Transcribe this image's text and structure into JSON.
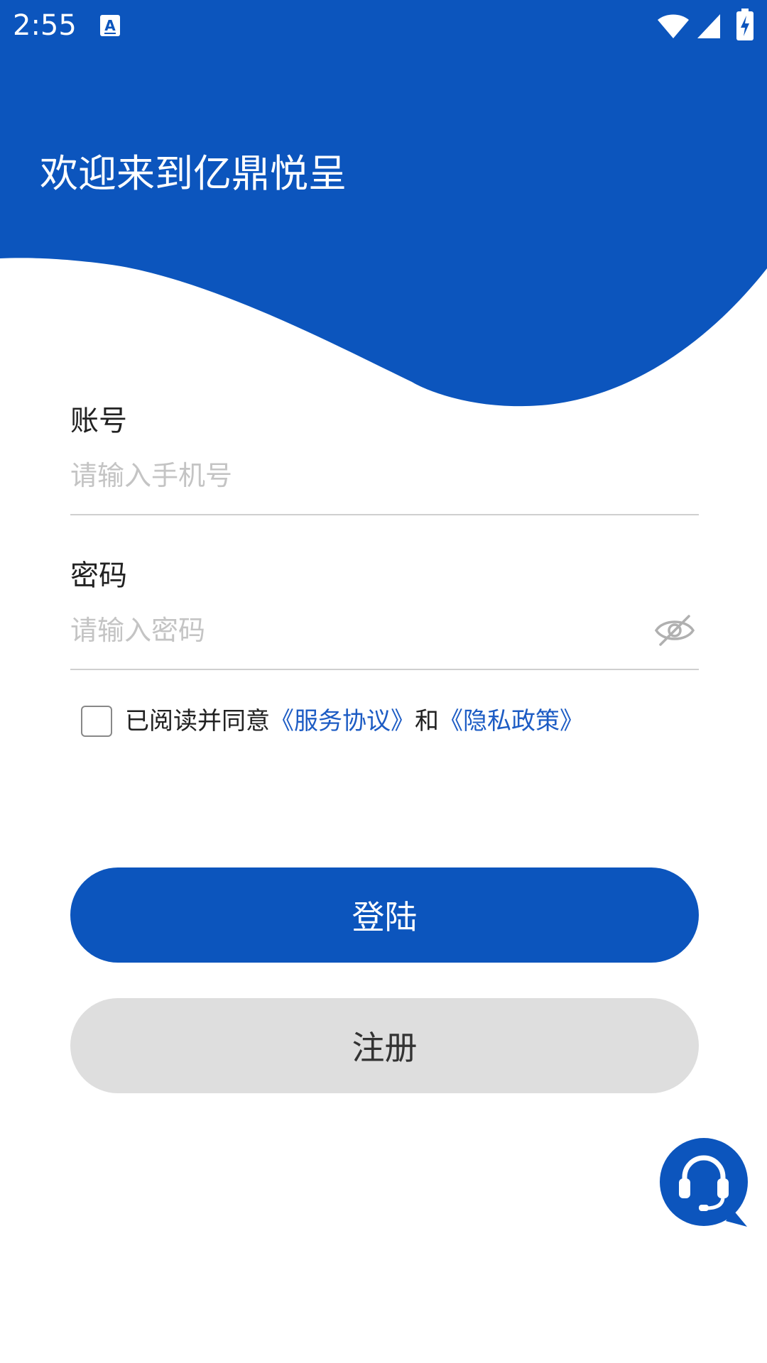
{
  "colors": {
    "brand": "#0c55bd",
    "link": "#1d5cc4",
    "register_bg": "#dedede"
  },
  "status_bar": {
    "time": "2:55",
    "icons": [
      "keyboard-a-icon",
      "wifi-icon",
      "signal-icon",
      "battery-charging-icon"
    ]
  },
  "header": {
    "welcome": "欢迎来到亿鼎悦呈"
  },
  "account": {
    "label": "账号",
    "placeholder": "请输入手机号",
    "value": ""
  },
  "password": {
    "label": "密码",
    "placeholder": "请输入密码",
    "value": "",
    "toggle_icon": "eye-off-icon"
  },
  "agreement": {
    "checked": false,
    "prefix": "已阅读并同意",
    "service_link": "《服务协议》",
    "conjunction": "和",
    "privacy_link": "《隐私政策》"
  },
  "buttons": {
    "login": "登陆",
    "register": "注册"
  },
  "support": {
    "icon": "customer-service-headset-icon"
  }
}
